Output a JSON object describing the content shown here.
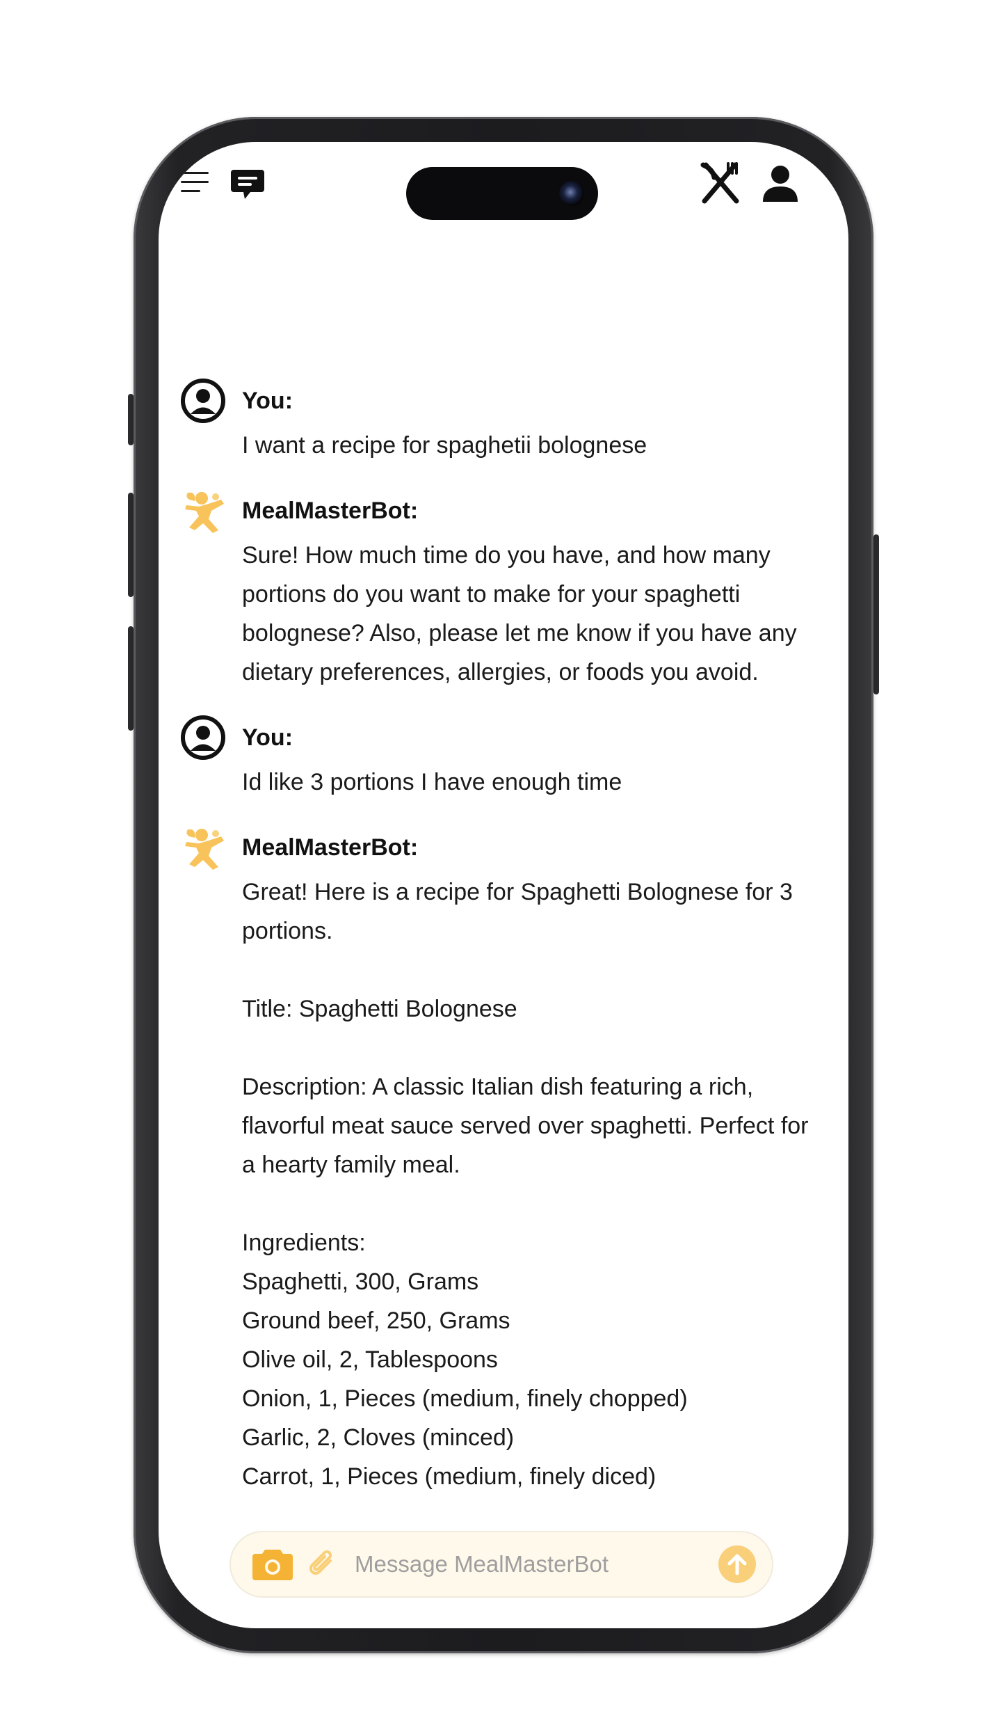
{
  "colors": {
    "accent": "#f5b335",
    "accent_light": "#f9cf7a",
    "text": "#1a1a1a",
    "frame": "#1c1c1f"
  },
  "topbar": {
    "menu_icon": "hamburger-menu-icon",
    "chat_icon": "chat-bubble-icon",
    "utensils_icon": "fork-knife-icon",
    "profile_icon": "user-icon"
  },
  "messages": [
    {
      "role": "user",
      "author": "You:",
      "avatar_icon": "user-circle-icon",
      "text": "I want a recipe for spaghetii bolognese"
    },
    {
      "role": "bot",
      "author": "MealMasterBot:",
      "avatar_icon": "chef-logo-icon",
      "text": "Sure! How much time do you have, and how many portions do you want to make for your spaghetti bolognese? Also, please let me know if you have any dietary preferences, allergies, or foods you avoid."
    },
    {
      "role": "user",
      "author": "You:",
      "avatar_icon": "user-circle-icon",
      "text": "Id like 3 portions I have enough time"
    },
    {
      "role": "bot",
      "author": "MealMasterBot:",
      "avatar_icon": "chef-logo-icon",
      "text": "Great! Here is a recipe for Spaghetti Bolognese for 3 portions.\n\nTitle: Spaghetti Bolognese\n\nDescription: A classic Italian dish featuring a rich, flavorful meat sauce served over spaghetti. Perfect for a hearty family meal.\n\nIngredients:\nSpaghetti, 300, Grams\nGround beef, 250, Grams\nOlive oil, 2, Tablespoons\nOnion, 1, Pieces (medium, finely chopped)\nGarlic, 2, Cloves (minced)\nCarrot, 1, Pieces (medium, finely diced)"
    }
  ],
  "composer": {
    "placeholder": "Message MealMasterBot",
    "camera_icon": "camera-icon",
    "attach_icon": "paperclip-icon",
    "send_icon": "send-arrow-up-icon"
  }
}
